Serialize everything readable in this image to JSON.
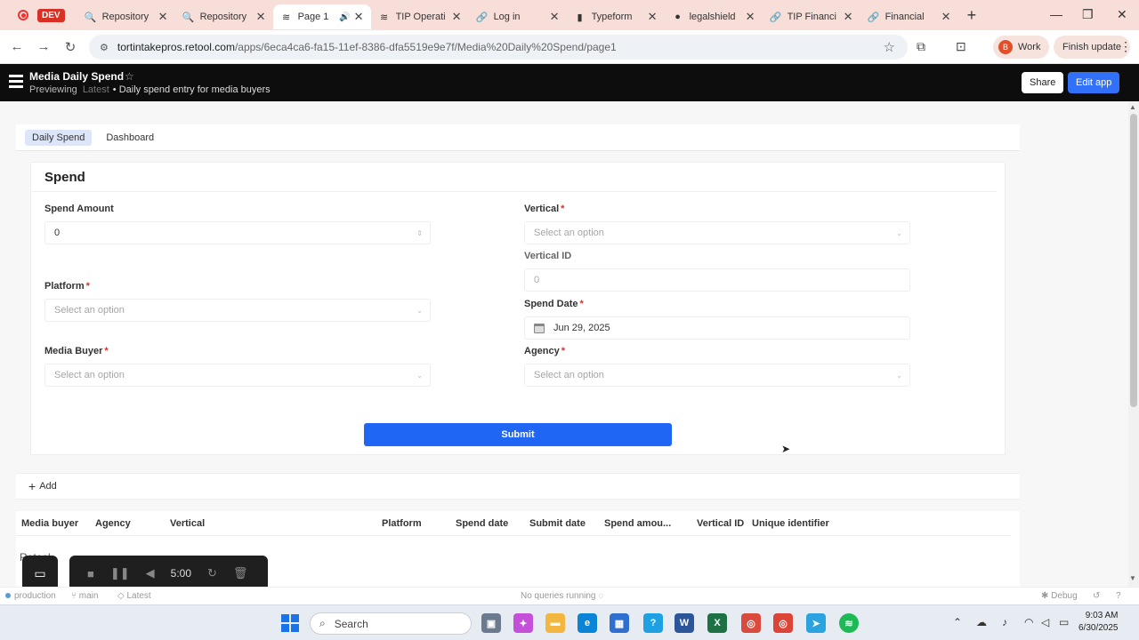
{
  "browser": {
    "dev_badge": "DEV",
    "tabs": [
      {
        "label": "Repository",
        "icon": "search-icon"
      },
      {
        "label": "Repository",
        "icon": "search-icon"
      },
      {
        "label": "Page 1",
        "icon": "retool-icon",
        "active": true
      },
      {
        "label": "TIP Operati",
        "icon": "retool-icon"
      },
      {
        "label": "Log in",
        "icon": "link-icon"
      },
      {
        "label": "Typeform",
        "icon": "typeform-icon"
      },
      {
        "label": "legalshield",
        "icon": "github-icon"
      },
      {
        "label": "TIP Financi",
        "icon": "link-icon"
      },
      {
        "label": "Financial",
        "icon": "link-icon"
      }
    ],
    "url_host": "tortintakepros.retool.com",
    "url_path": "/apps/6eca4ca6-fa15-11ef-8386-dfa5519e9e7f/Media%20Daily%20Spend/page1",
    "profile_initial": "B",
    "profile_label": "Work",
    "finish_update": "Finish update"
  },
  "app": {
    "title": "Media Daily Spend",
    "mode": "Previewing",
    "version": "Latest",
    "description": "• Daily spend entry for media buyers",
    "share_label": "Share",
    "edit_label": "Edit app",
    "nav_tabs": [
      "Daily Spend",
      "Dashboard"
    ],
    "form": {
      "title": "Spend",
      "spend_amount_label": "Spend Amount",
      "spend_amount_value": "0",
      "platform_label": "Platform",
      "platform_placeholder": "Select an option",
      "media_buyer_label": "Media Buyer",
      "media_buyer_placeholder": "Select an option",
      "vertical_label": "Vertical",
      "vertical_placeholder": "Select an option",
      "vertical_id_label": "Vertical ID",
      "vertical_id_value": "0",
      "spend_date_label": "Spend Date",
      "spend_date_value": "Jun 29, 2025",
      "agency_label": "Agency",
      "agency_placeholder": "Select an option",
      "required_mark": "*",
      "submit_label": "Submit"
    },
    "add_label": "Add",
    "table_columns": [
      "Media buyer",
      "Agency",
      "Vertical",
      "Platform",
      "Spend date",
      "Submit date",
      "Spend amou...",
      "Vertical ID",
      "Unique identifier"
    ],
    "retool_ghost": "Retool"
  },
  "recorder": {
    "time": "5:00"
  },
  "statusbar": {
    "env": "production",
    "branch": "main",
    "version": "Latest",
    "queries": "No queries running",
    "debug": "Debug"
  },
  "taskbar": {
    "search_label": "Search",
    "time": "9:03 AM",
    "date": "6/30/2025"
  },
  "colors": {
    "primary_button": "#1f66f4",
    "edit_button": "#3170f9",
    "tab_strip": "#f8ded8",
    "required": "#d3322e"
  }
}
